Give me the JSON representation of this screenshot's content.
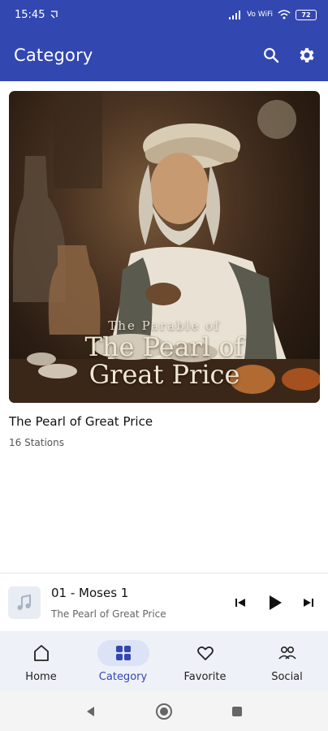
{
  "status": {
    "time": "15:45",
    "network": "Vo WiFi",
    "battery": "72"
  },
  "app_bar": {
    "title": "Category",
    "search_icon": "search-icon",
    "settings_icon": "gear-icon"
  },
  "category_item": {
    "cover_line1": "The Parable of",
    "cover_line2": "The Pearl of",
    "cover_line3": "Great Price",
    "title": "The Pearl of Great Price",
    "subtitle": "16 Stations"
  },
  "player": {
    "track_title": "01 - Moses 1",
    "track_subtitle": "The Pearl of Great Price"
  },
  "nav": {
    "items": [
      {
        "label": "Home",
        "icon": "home-icon"
      },
      {
        "label": "Category",
        "icon": "grid-icon"
      },
      {
        "label": "Favorite",
        "icon": "heart-icon"
      },
      {
        "label": "Social",
        "icon": "people-icon"
      }
    ]
  },
  "colors": {
    "primary": "#3347b0",
    "nav_bg": "#eef1f7",
    "nav_active_bg": "#dde3f6"
  }
}
